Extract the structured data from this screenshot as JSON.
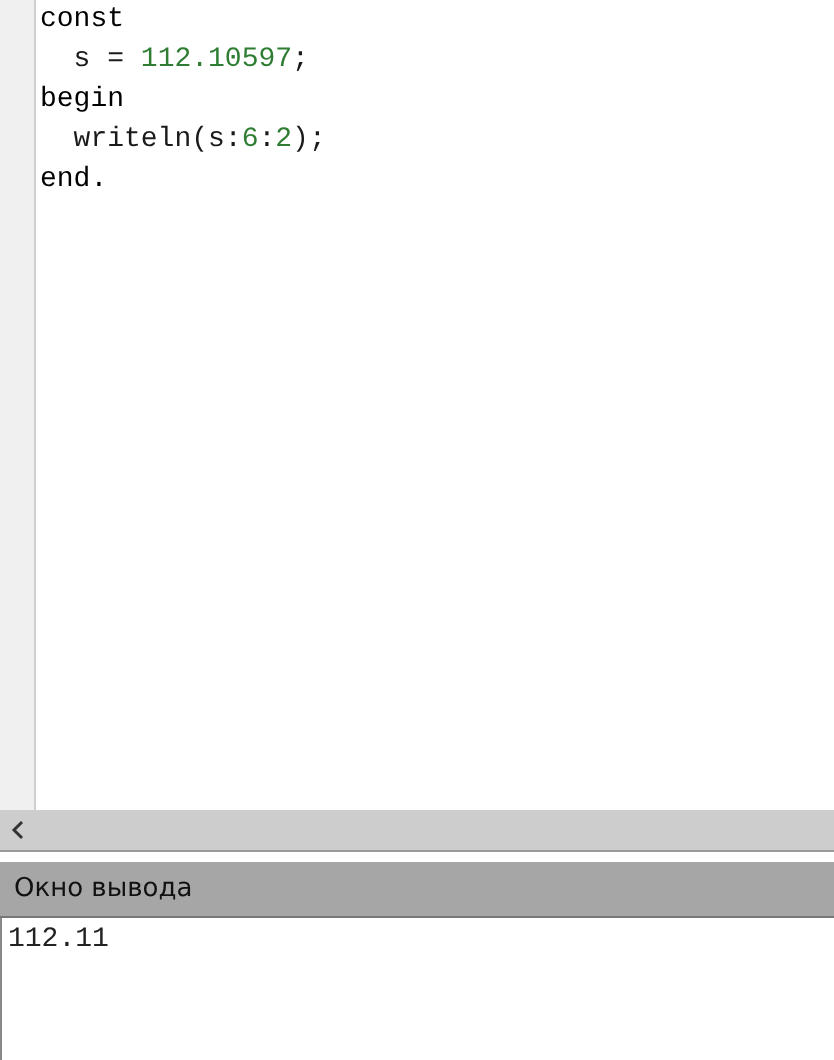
{
  "editor": {
    "lines": [
      [
        {
          "kind": "keyword",
          "text": "const"
        }
      ],
      [
        {
          "kind": "plain",
          "text": "  s = "
        },
        {
          "kind": "number",
          "text": "112.10597"
        },
        {
          "kind": "plain",
          "text": ";"
        }
      ],
      [
        {
          "kind": "keyword",
          "text": "begin"
        }
      ],
      [
        {
          "kind": "plain",
          "text": "  writeln(s:"
        },
        {
          "kind": "number",
          "text": "6"
        },
        {
          "kind": "plain",
          "text": ":"
        },
        {
          "kind": "number",
          "text": "2"
        },
        {
          "kind": "plain",
          "text": ");"
        }
      ],
      [
        {
          "kind": "keyword",
          "text": "end."
        }
      ]
    ]
  },
  "output_panel": {
    "title": "Окно вывода",
    "lines": [
      "112.11"
    ]
  }
}
